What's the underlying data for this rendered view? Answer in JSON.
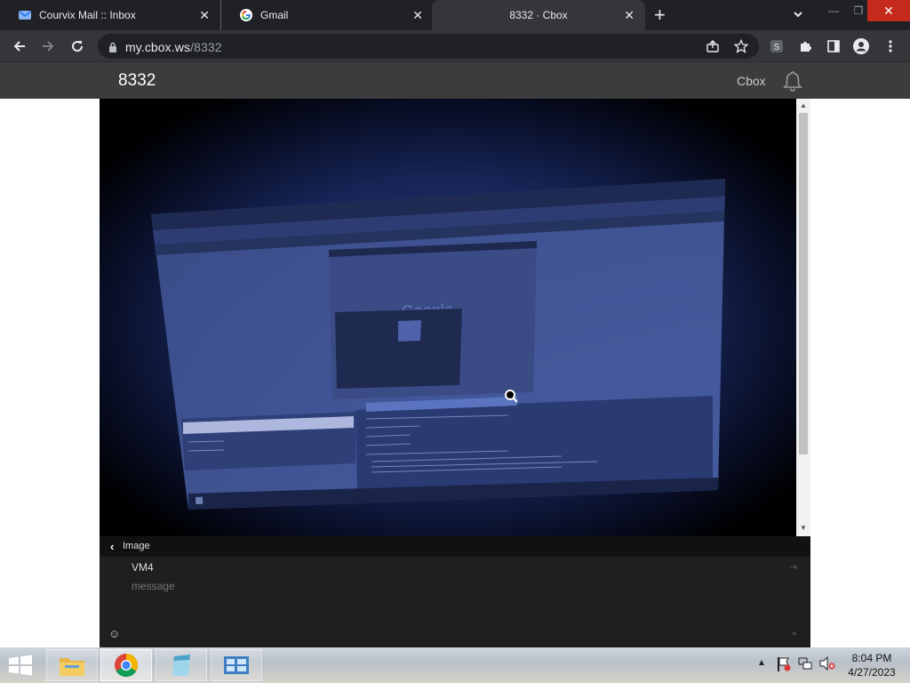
{
  "browser": {
    "tabs": [
      {
        "title": "Courvix Mail :: Inbox",
        "favicon": "mail-icon"
      },
      {
        "title": "Gmail",
        "favicon": "google-icon"
      },
      {
        "title": "8332 · Cbox",
        "favicon": "none",
        "active": true
      }
    ],
    "url_host": "my.cbox.ws",
    "url_path": "/8332"
  },
  "cbox": {
    "title": "8332",
    "brand": "Cbox"
  },
  "viewer": {
    "label": "Image",
    "photo_description_icon": "photo-of-monitor"
  },
  "message": {
    "name": "VM4",
    "placeholder": "message"
  },
  "taskbar": {
    "apps": [
      "file-explorer-icon",
      "chrome-icon",
      "notepad-icon",
      "control-panel-icon"
    ],
    "time": "8:04 PM",
    "date": "4/27/2023"
  },
  "colors": {
    "tabstrip": "#202124",
    "toolbar": "#35363a",
    "cbox_header": "#3c3c3c",
    "message_bg": "#1f1f1f",
    "close_red": "#c42b1c"
  }
}
